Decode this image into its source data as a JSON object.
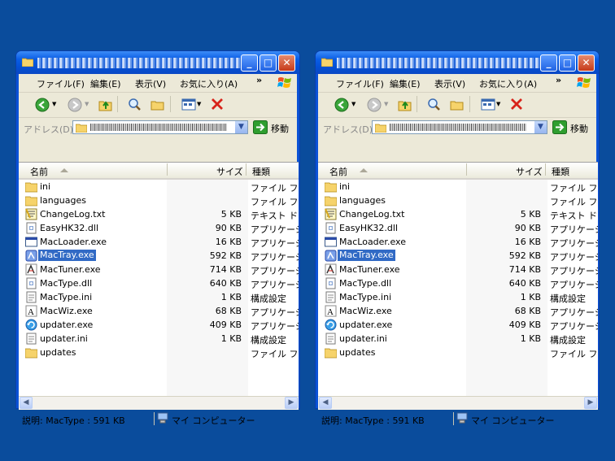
{
  "menu": [
    {
      "label": "ファイル(F)"
    },
    {
      "label": "編集(E)"
    },
    {
      "label": "表示(V)"
    },
    {
      "label": "お気に入り(A)"
    }
  ],
  "menu_overflow": "»",
  "address": {
    "label": "アドレス(D)",
    "go_label": "移動"
  },
  "columns": {
    "name": "名前",
    "size": "サイズ",
    "type": "種類"
  },
  "files": [
    {
      "name": "ini",
      "size": "",
      "type": "ファイル フォル",
      "icon": "folder-icon"
    },
    {
      "name": "languages",
      "size": "",
      "type": "ファイル フォル",
      "icon": "folder-icon"
    },
    {
      "name": "ChangeLog.txt",
      "size": "5 KB",
      "type": "テキスト ドキ",
      "icon": "text-file-icon"
    },
    {
      "name": "EasyHK32.dll",
      "size": "90 KB",
      "type": "アプリケーショ",
      "icon": "dll-icon"
    },
    {
      "name": "MacLoader.exe",
      "size": "16 KB",
      "type": "アプリケーショ",
      "icon": "exe-window-icon"
    },
    {
      "name": "MacTray.exe",
      "size": "592 KB",
      "type": "アプリケーショ",
      "icon": "mactype-icon"
    },
    {
      "name": "MacTuner.exe",
      "size": "714 KB",
      "type": "アプリケーショ",
      "icon": "tuner-icon"
    },
    {
      "name": "MacType.dll",
      "size": "640 KB",
      "type": "アプリケーショ",
      "icon": "dll-icon"
    },
    {
      "name": "MacType.ini",
      "size": "1 KB",
      "type": "構成設定",
      "icon": "ini-icon"
    },
    {
      "name": "MacWiz.exe",
      "size": "68 KB",
      "type": "アプリケーショ",
      "icon": "font-icon"
    },
    {
      "name": "updater.exe",
      "size": "409 KB",
      "type": "アプリケーショ",
      "icon": "updater-icon"
    },
    {
      "name": "updater.ini",
      "size": "1 KB",
      "type": "構成設定",
      "icon": "ini-icon"
    },
    {
      "name": "updates",
      "size": "",
      "type": "ファイル フォル",
      "icon": "folder-icon"
    }
  ],
  "selected_file": "MacTray.exe",
  "status": {
    "description": "説明: MacType : 591 KB",
    "location": "マイ コンピューター"
  },
  "colors": {
    "desktop": "#0a4c9c",
    "selection": "#316ac5",
    "titlebar": "#0a5ee6"
  }
}
